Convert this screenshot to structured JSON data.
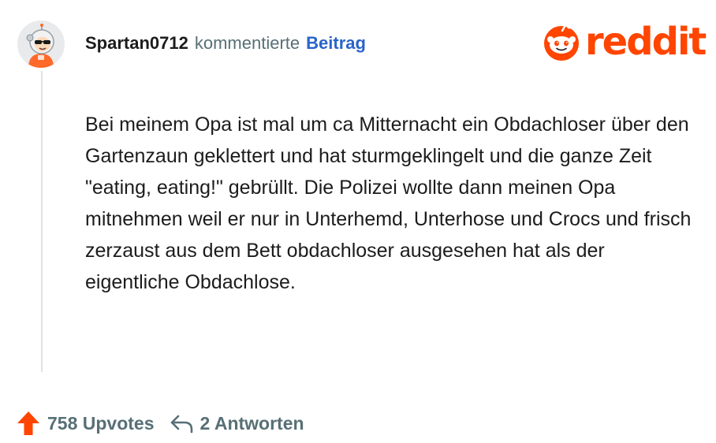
{
  "comment": {
    "username": "Spartan0712",
    "action": "kommentierte",
    "post_link": "Beitrag",
    "avatar_icon": "astronaut-avatar-icon",
    "text": "Bei meinem Opa ist mal um ca Mitternacht ein Obdachloser über den Gartenzaun geklettert und hat sturmgeklingelt und die ganze Zeit \"eating, eating!\" gebrüllt. Die Polizei wollte dann meinen Opa mitnehmen weil er nur in Unterhemd, Unterhose und Crocs und frisch zerzaust aus dem Bett obdachloser ausgesehen hat als der eigentliche Obdachlose."
  },
  "footer": {
    "upvotes_label": "758 Upvotes",
    "replies_label": "2 Antworten",
    "upvote_icon": "upvote-arrow-icon",
    "reply_icon": "reply-arrow-icon"
  },
  "brand": {
    "wordmark": "reddit",
    "logo_icon": "reddit-snoo-icon",
    "accent_color": "#ff4500"
  }
}
